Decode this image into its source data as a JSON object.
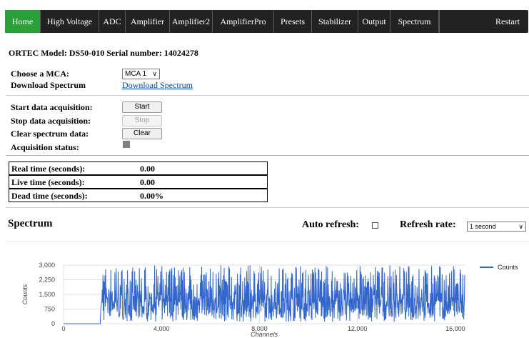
{
  "nav": {
    "items": [
      {
        "label": "Home",
        "active": true
      },
      {
        "label": "High Voltage"
      },
      {
        "label": "ADC"
      },
      {
        "label": "Amplifier"
      },
      {
        "label": "Amplifier2"
      },
      {
        "label": "AmplifierPro"
      },
      {
        "label": "Presets"
      },
      {
        "label": "Stabilizer"
      },
      {
        "label": "Output"
      },
      {
        "label": "Spectrum"
      },
      {
        "label": "Restart"
      }
    ]
  },
  "device": {
    "info": "ORTEC Model: DS50-010 Serial number: 14024278"
  },
  "mca": {
    "choose_label": "Choose a MCA:",
    "selected": "MCA 1",
    "download_label": "Download Spectrum",
    "download_link": "Download Spectrum"
  },
  "acquisition": {
    "start_label": "Start data acquisition:",
    "start_button": "Start",
    "stop_label": "Stop data acquisition:",
    "stop_button": "Stop",
    "clear_label": "Clear spectrum data:",
    "clear_button": "Clear",
    "status_label": "Acquisition status:",
    "status_color": "#808080"
  },
  "times": {
    "real_label": "Real time (seconds):",
    "real_value": "0.00",
    "live_label": "Live time (seconds):",
    "live_value": "0.00",
    "dead_label": "Dead time (seconds):",
    "dead_value": "0.00%"
  },
  "spectrum": {
    "title": "Spectrum",
    "auto_refresh_label": "Auto refresh:",
    "auto_refresh_checked": false,
    "refresh_rate_label": "Refresh rate:",
    "refresh_rate_value": "1 second"
  },
  "chart_data": {
    "type": "line",
    "xlabel": "Channels",
    "ylabel": "Counts",
    "xlim": [
      0,
      16384
    ],
    "ylim": [
      0,
      3000
    ],
    "x_ticks": [
      "0",
      "4,000",
      "8,000",
      "12,000",
      "16,000"
    ],
    "y_ticks": [
      "0",
      "750",
      "1,500",
      "2,250",
      "3,000"
    ],
    "series": [
      {
        "name": "Counts",
        "color": "#3366cc",
        "description_values": {
          "channels_0_to_1500": 0,
          "channels_1500_to_16384_range": [
            0,
            3000
          ]
        }
      }
    ],
    "legend_position": "right",
    "grid": true
  }
}
